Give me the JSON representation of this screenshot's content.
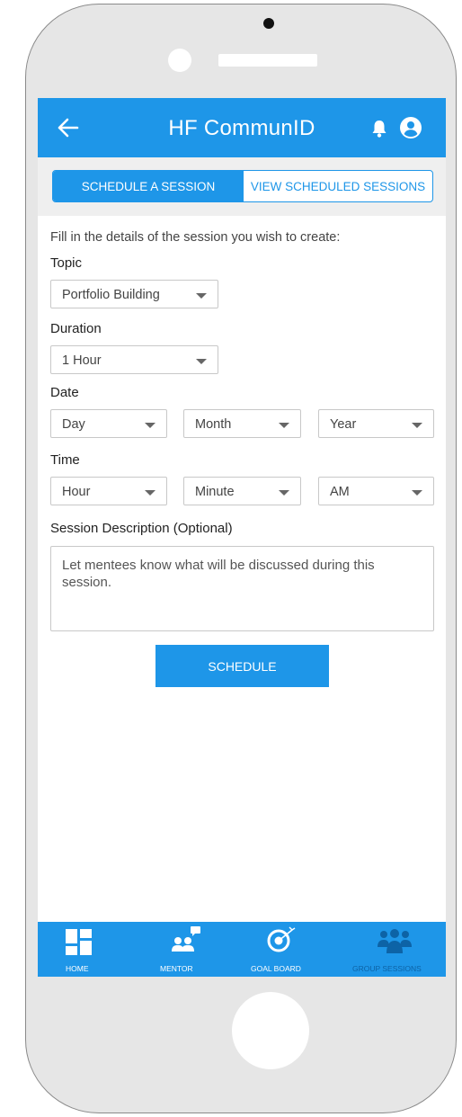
{
  "header": {
    "title": "HF CommunID",
    "back_icon": "back-arrow-icon",
    "bell_icon": "bell-icon",
    "profile_icon": "profile-icon"
  },
  "tabs": [
    {
      "label": "SCHEDULE A SESSION",
      "active": true
    },
    {
      "label": "VIEW SCHEDULED SESSIONS",
      "active": false
    }
  ],
  "form": {
    "intro": "Fill in the details of the session you wish to create:",
    "topic": {
      "label": "Topic",
      "value": "Portfolio Building"
    },
    "duration": {
      "label": "Duration",
      "value": "1 Hour"
    },
    "date": {
      "label": "Date",
      "day": "Day",
      "month": "Month",
      "year": "Year"
    },
    "time": {
      "label": "Time",
      "hour": "Hour",
      "minute": "Minute",
      "ampm": "AM"
    },
    "description": {
      "label": "Session Description (Optional)",
      "placeholder": "Let mentees know what will be discussed during this session."
    },
    "submit_label": "SCHEDULE"
  },
  "bottom_nav": [
    {
      "label": "HOME",
      "icon": "home-grid-icon",
      "active": true
    },
    {
      "label": "MENTOR",
      "icon": "mentor-icon",
      "active": true
    },
    {
      "label": "GOAL BOARD",
      "icon": "target-icon",
      "active": true
    },
    {
      "label": "GROUP SESSIONS",
      "icon": "group-icon",
      "active": false
    }
  ],
  "colors": {
    "primary": "#1e96e8",
    "inactive_nav": "#0d63a6"
  }
}
